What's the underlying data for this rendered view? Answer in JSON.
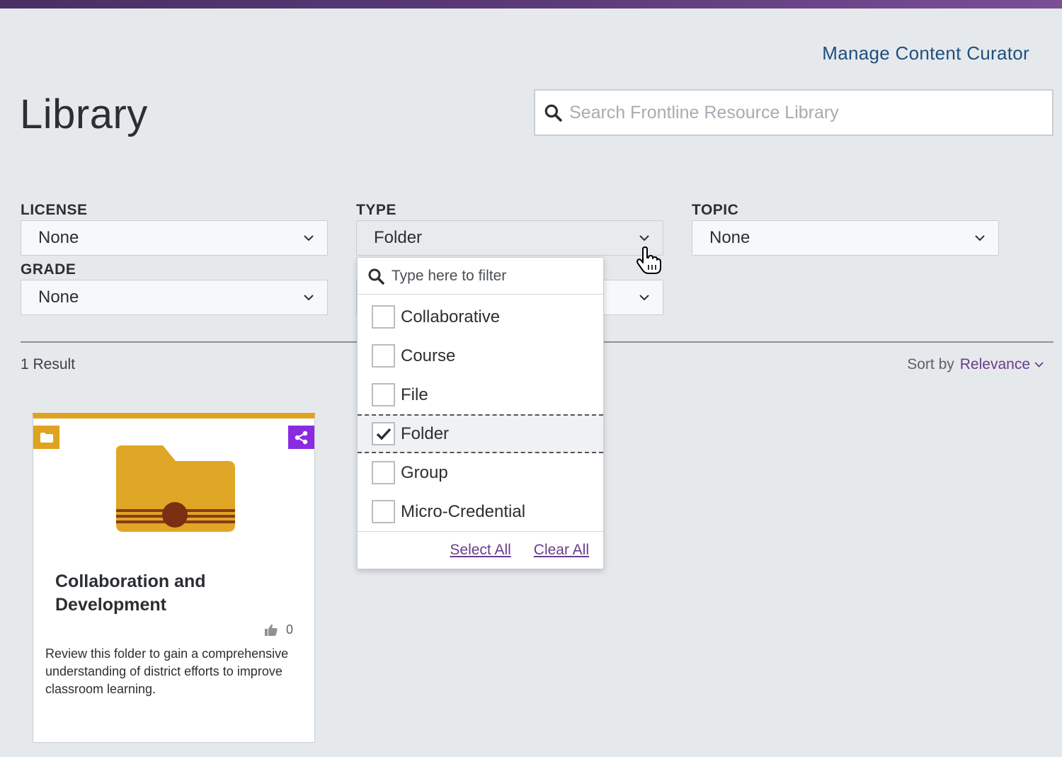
{
  "header": {
    "manage_link": "Manage Content Curator",
    "title": "Library",
    "search_placeholder": "Search Frontline Resource Library"
  },
  "filters": {
    "license": {
      "label": "LICENSE",
      "value": "None"
    },
    "type": {
      "label": "TYPE",
      "value": "Folder"
    },
    "topic": {
      "label": "TOPIC",
      "value": "None"
    },
    "grade": {
      "label": "GRADE",
      "value": "None"
    }
  },
  "dropdown": {
    "filter_placeholder": "Type here to filter",
    "options": [
      {
        "label": "Collaborative",
        "checked": false
      },
      {
        "label": "Course",
        "checked": false
      },
      {
        "label": "File",
        "checked": false
      },
      {
        "label": "Folder",
        "checked": true
      },
      {
        "label": "Group",
        "checked": false
      },
      {
        "label": "Micro-Credential",
        "checked": false
      }
    ],
    "select_all": "Select All",
    "clear_all": "Clear All"
  },
  "results": {
    "count": "1 Result",
    "sort_label": "Sort by",
    "sort_value": "Relevance"
  },
  "card": {
    "title": "Collaboration and Development",
    "likes": "0",
    "description": "Review this folder to gain a comprehensive understanding of district efforts to improve classroom learning.",
    "accent_color": "#e0a320",
    "share_color": "#8a2be2"
  },
  "colors": {
    "top_bar": "#5a3a78",
    "link": "#1f4f7d",
    "purple_link": "#6a3b8c",
    "background": "#e6e9ec"
  }
}
